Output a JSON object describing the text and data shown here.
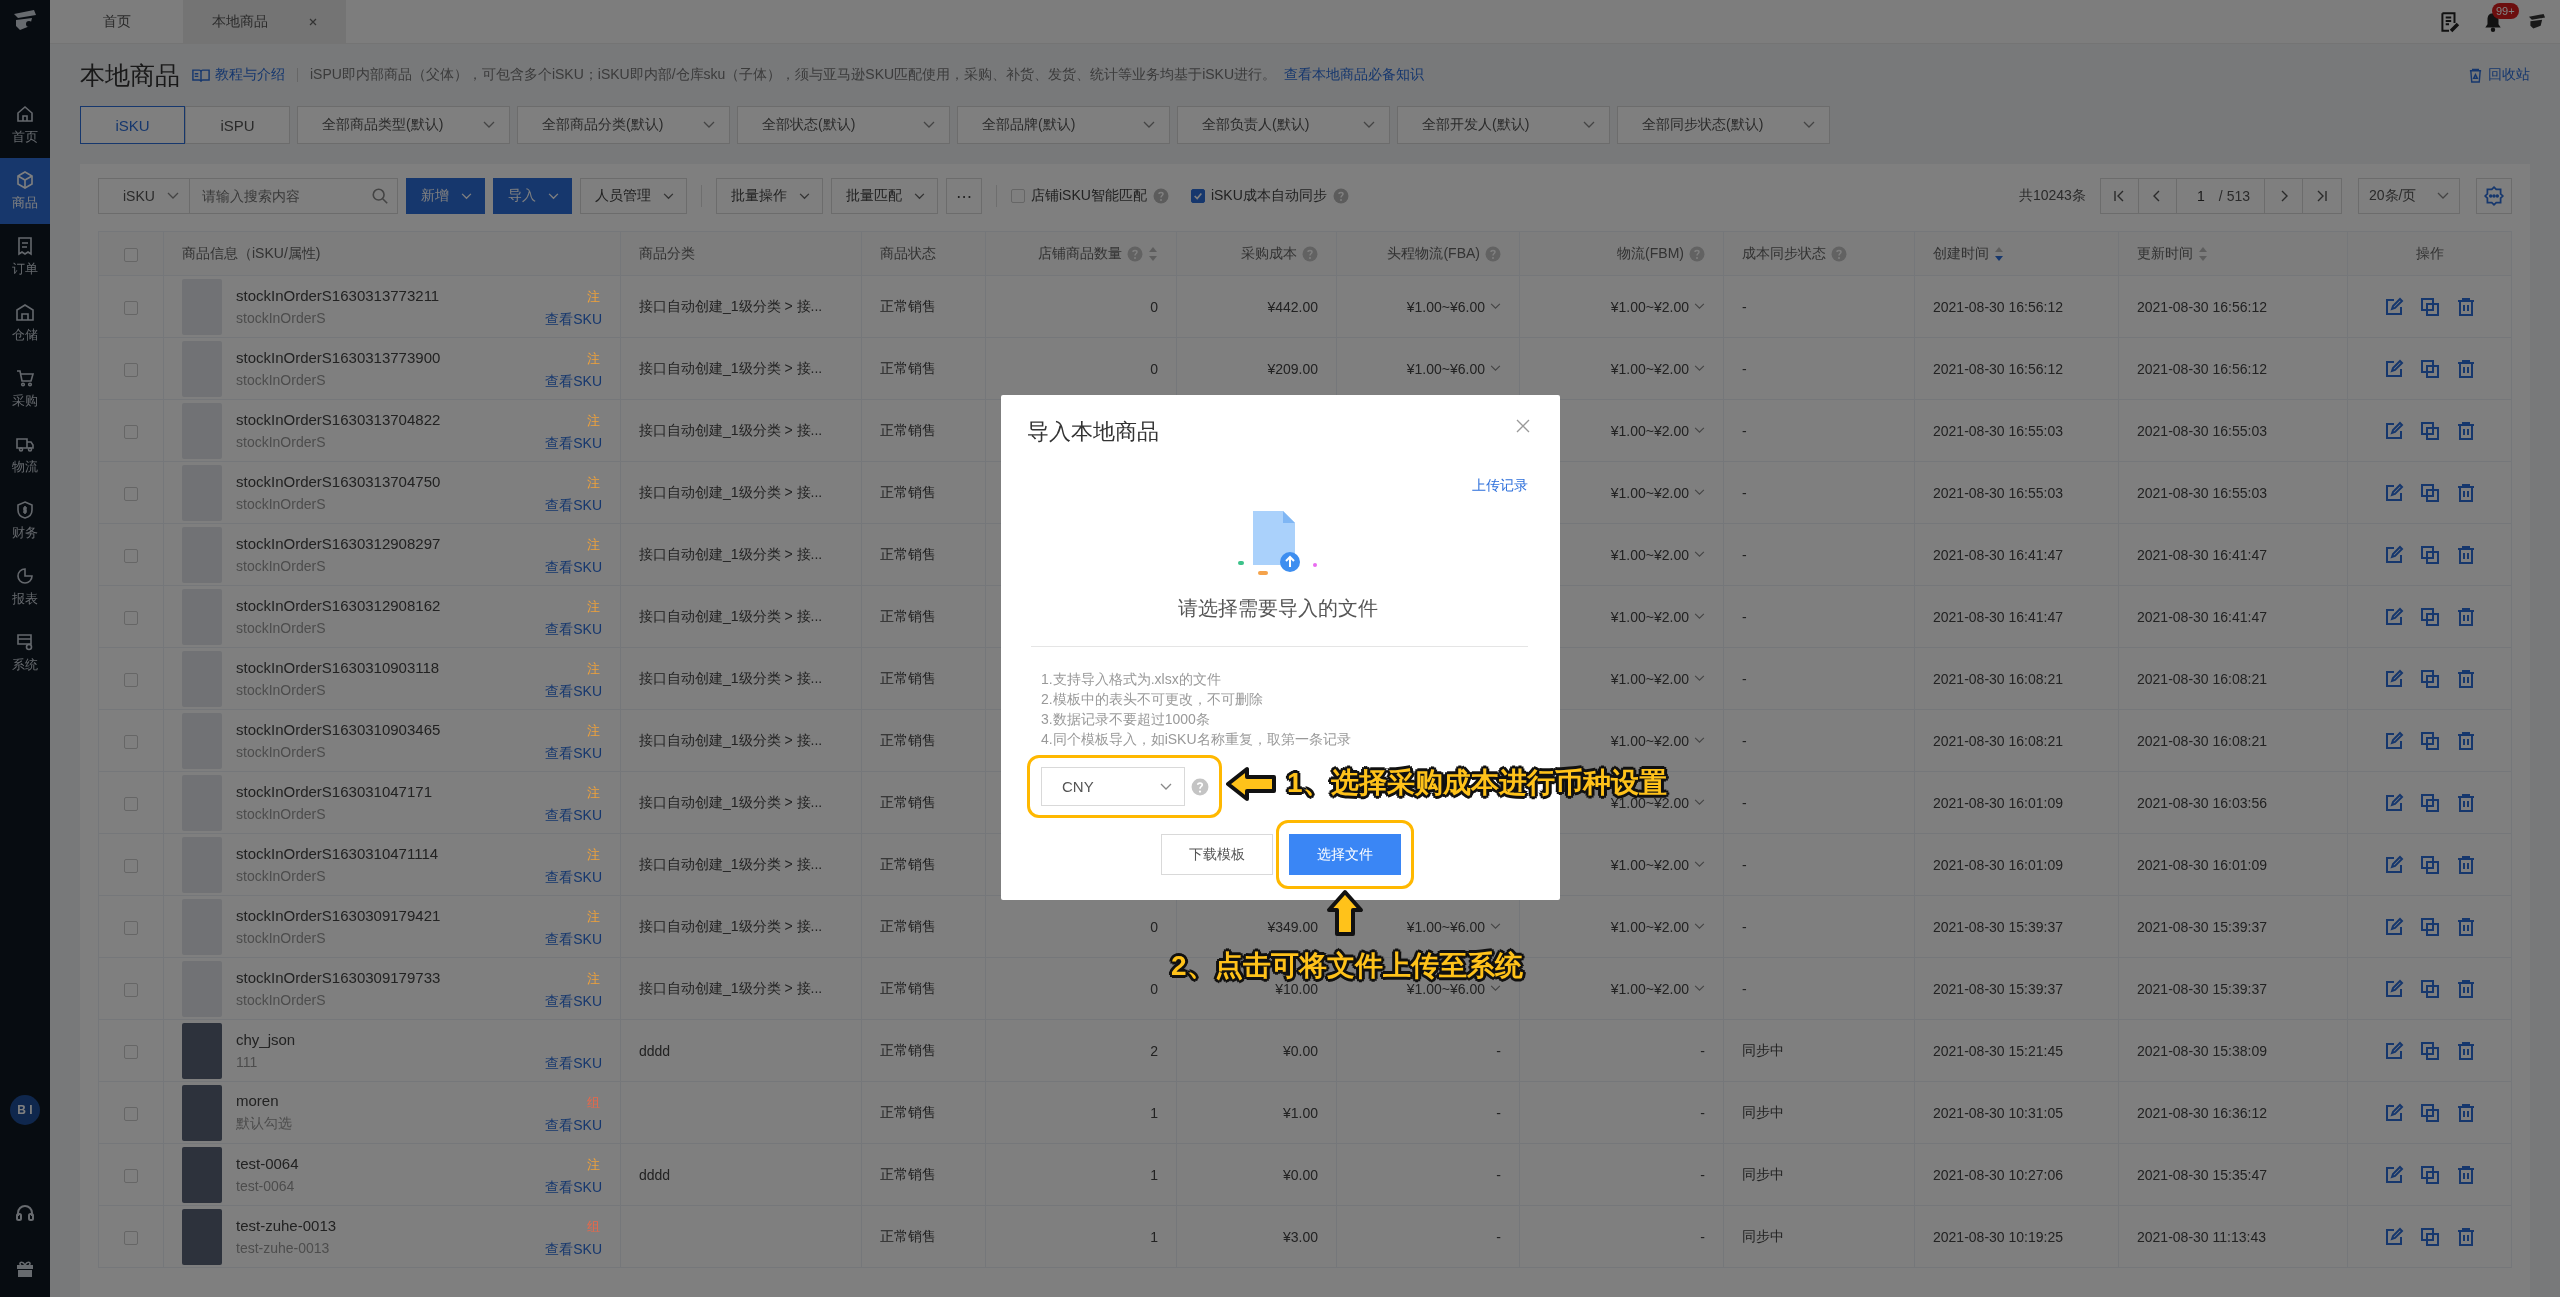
{
  "sidebar": {
    "items": [
      {
        "label": "首页",
        "kind": "home",
        "selected": false
      },
      {
        "label": "商品",
        "kind": "cube",
        "selected": true
      },
      {
        "label": "订单",
        "kind": "order",
        "selected": false
      },
      {
        "label": "仓储",
        "kind": "warehouse",
        "selected": false
      },
      {
        "label": "采购",
        "kind": "cart",
        "selected": false
      },
      {
        "label": "物流",
        "kind": "truck",
        "selected": false
      },
      {
        "label": "财务",
        "kind": "finance",
        "selected": false
      },
      {
        "label": "报表",
        "kind": "report",
        "selected": false
      },
      {
        "label": "系统",
        "kind": "system",
        "selected": false
      }
    ],
    "bi_badge": "B I"
  },
  "tabs": [
    {
      "label": "首页",
      "selected": false,
      "closable": false
    },
    {
      "label": "本地商品",
      "selected": true,
      "closable": true
    }
  ],
  "notification_count": "99+",
  "header": {
    "title": "本地商品",
    "tutorial_link": "教程与介绍",
    "description": "iSPU即内部商品（父体），可包含多个iSKU；iSKU即内部/仓库sku（子体），须与亚马逊SKU匹配使用，采购、补货、发货、统计等业务均基于iSKU进行。",
    "knowledge_link": "查看本地商品必备知识",
    "recycle_bin": "回收站"
  },
  "view_switch": [
    {
      "label": "iSKU",
      "selected": true
    },
    {
      "label": "iSPU",
      "selected": false
    }
  ],
  "filters": [
    "全部商品类型(默认)",
    "全部商品分类(默认)",
    "全部状态(默认)",
    "全部品牌(默认)",
    "全部负责人(默认)",
    "全部开发人(默认)",
    "全部同步状态(默认)"
  ],
  "toolbar": {
    "search_type": "iSKU",
    "search_placeholder": "请输入搜索内容",
    "button_groups": [
      [
        {
          "label": "新增",
          "kind": "primary"
        },
        {
          "label": "导入",
          "kind": "primary"
        },
        {
          "label": "人员管理",
          "kind": "dropdown"
        }
      ],
      [
        {
          "label": "批量操作",
          "kind": "dropdown"
        },
        {
          "label": "批量匹配",
          "kind": "dropdown"
        },
        {
          "label": "⋯",
          "kind": "more"
        }
      ]
    ],
    "checkboxes": [
      {
        "label": "店铺iSKU智能匹配",
        "checked": false
      },
      {
        "label": "iSKU成本自动同步",
        "checked": true
      }
    ]
  },
  "pagination": {
    "total": "共10243条",
    "page": "1",
    "pages": "/ 513",
    "page_size": "20条/页"
  },
  "table": {
    "select_all": {
      "checked": false
    },
    "columns": [
      {
        "label": "商品信息（iSKU/属性)",
        "kind": "plain"
      },
      {
        "label": "商品分类",
        "kind": "plain"
      },
      {
        "label": "商品状态",
        "kind": "plain"
      },
      {
        "label": "店铺商品数量",
        "kind": "help_sortable"
      },
      {
        "label": "采购成本",
        "kind": "help"
      },
      {
        "label": "头程物流(FBA)",
        "kind": "help"
      },
      {
        "label": "物流(FBM)",
        "kind": "help"
      },
      {
        "label": "成本同步状态",
        "kind": "help"
      },
      {
        "label": "创建时间",
        "kind": "sorted_desc"
      },
      {
        "label": "更新时间",
        "kind": "sortable"
      },
      {
        "label": "操作",
        "kind": "plain"
      }
    ],
    "rows": [
      {
        "selected": false,
        "photo": false,
        "name": "stockInOrderS1630313773211",
        "attr": "stockInOrderS",
        "tag": {
          "text": "注",
          "color": "#f0a23a"
        },
        "link": "查看SKU",
        "category": "接口自动创建_1级分类 > 接...",
        "status": "正常销售",
        "count": "0",
        "cost": "¥442.00",
        "fba": "¥1.00~¥6.00",
        "fbm": "¥1.00~¥2.00",
        "range_dropdown": true,
        "sync": "-",
        "created": "2021-08-30 16:56:12",
        "updated": "2021-08-30 16:56:12"
      },
      {
        "selected": false,
        "photo": false,
        "name": "stockInOrderS1630313773900",
        "attr": "stockInOrderS",
        "tag": {
          "text": "注",
          "color": "#f0a23a"
        },
        "link": "查看SKU",
        "category": "接口自动创建_1级分类 > 接...",
        "status": "正常销售",
        "count": "0",
        "cost": "¥209.00",
        "fba": "¥1.00~¥6.00",
        "fbm": "¥1.00~¥2.00",
        "range_dropdown": true,
        "sync": "-",
        "created": "2021-08-30 16:56:12",
        "updated": "2021-08-30 16:56:12"
      },
      {
        "selected": false,
        "photo": false,
        "name": "stockInOrderS1630313704822",
        "attr": "stockInOrderS",
        "tag": {
          "text": "注",
          "color": "#f0a23a"
        },
        "link": "查看SKU",
        "category": "接口自动创建_1级分类 > 接...",
        "status": "正常销售",
        "fbm": "¥1.00~¥2.00",
        "range_dropdown": true,
        "sync": "-",
        "created": "2021-08-30 16:55:03",
        "updated": "2021-08-30 16:55:03"
      },
      {
        "selected": false,
        "photo": false,
        "name": "stockInOrderS1630313704750",
        "attr": "stockInOrderS",
        "tag": {
          "text": "注",
          "color": "#f0a23a"
        },
        "link": "查看SKU",
        "category": "接口自动创建_1级分类 > 接...",
        "status": "正常销售",
        "fbm": "¥1.00~¥2.00",
        "range_dropdown": true,
        "sync": "-",
        "created": "2021-08-30 16:55:03",
        "updated": "2021-08-30 16:55:03"
      },
      {
        "selected": false,
        "photo": false,
        "name": "stockInOrderS1630312908297",
        "attr": "stockInOrderS",
        "tag": {
          "text": "注",
          "color": "#f0a23a"
        },
        "link": "查看SKU",
        "category": "接口自动创建_1级分类 > 接...",
        "status": "正常销售",
        "fbm": "¥1.00~¥2.00",
        "range_dropdown": true,
        "sync": "-",
        "created": "2021-08-30 16:41:47",
        "updated": "2021-08-30 16:41:47"
      },
      {
        "selected": false,
        "photo": false,
        "name": "stockInOrderS1630312908162",
        "attr": "stockInOrderS",
        "tag": {
          "text": "注",
          "color": "#f0a23a"
        },
        "link": "查看SKU",
        "category": "接口自动创建_1级分类 > 接...",
        "status": "正常销售",
        "fbm": "¥1.00~¥2.00",
        "range_dropdown": true,
        "sync": "-",
        "created": "2021-08-30 16:41:47",
        "updated": "2021-08-30 16:41:47"
      },
      {
        "selected": false,
        "photo": false,
        "name": "stockInOrderS1630310903118",
        "attr": "stockInOrderS",
        "tag": {
          "text": "注",
          "color": "#f0a23a"
        },
        "link": "查看SKU",
        "category": "接口自动创建_1级分类 > 接...",
        "status": "正常销售",
        "fbm": "¥1.00~¥2.00",
        "range_dropdown": true,
        "sync": "-",
        "created": "2021-08-30 16:08:21",
        "updated": "2021-08-30 16:08:21"
      },
      {
        "selected": false,
        "photo": false,
        "name": "stockInOrderS1630310903465",
        "attr": "stockInOrderS",
        "tag": {
          "text": "注",
          "color": "#f0a23a"
        },
        "link": "查看SKU",
        "category": "接口自动创建_1级分类 > 接...",
        "status": "正常销售",
        "fbm": "¥1.00~¥2.00",
        "range_dropdown": true,
        "sync": "-",
        "created": "2021-08-30 16:08:21",
        "updated": "2021-08-30 16:08:21"
      },
      {
        "selected": false,
        "photo": false,
        "name": "stockInOrderS163031047171",
        "attr": "stockInOrderS",
        "tag": {
          "text": "注",
          "color": "#f0a23a"
        },
        "link": "查看SKU",
        "category": "接口自动创建_1级分类 > 接...",
        "status": "正常销售",
        "fbm": "¥1.00~¥2.00",
        "range_dropdown": true,
        "sync": "-",
        "created": "2021-08-30 16:01:09",
        "updated": "2021-08-30 16:03:56"
      },
      {
        "selected": false,
        "photo": false,
        "name": "stockInOrderS1630310471114",
        "attr": "stockInOrderS",
        "tag": {
          "text": "注",
          "color": "#f0a23a"
        },
        "link": "查看SKU",
        "category": "接口自动创建_1级分类 > 接...",
        "status": "正常销售",
        "fbm": "¥1.00~¥2.00",
        "range_dropdown": true,
        "sync": "-",
        "created": "2021-08-30 16:01:09",
        "updated": "2021-08-30 16:01:09"
      },
      {
        "selected": false,
        "photo": false,
        "name": "stockInOrderS1630309179421",
        "attr": "stockInOrderS",
        "tag": {
          "text": "注",
          "color": "#f0a23a"
        },
        "link": "查看SKU",
        "category": "接口自动创建_1级分类 > 接...",
        "status": "正常销售",
        "count": "0",
        "cost": "¥349.00",
        "fba": "¥1.00~¥6.00",
        "fbm": "¥1.00~¥2.00",
        "range_dropdown": true,
        "sync": "-",
        "created": "2021-08-30 15:39:37",
        "updated": "2021-08-30 15:39:37"
      },
      {
        "selected": false,
        "photo": false,
        "name": "stockInOrderS1630309179733",
        "attr": "stockInOrderS",
        "tag": {
          "text": "注",
          "color": "#f0a23a"
        },
        "link": "查看SKU",
        "category": "接口自动创建_1级分类 > 接...",
        "status": "正常销售",
        "count": "0",
        "cost": "¥10.00",
        "fba": "¥1.00~¥6.00",
        "fbm": "¥1.00~¥2.00",
        "range_dropdown": true,
        "sync": "-",
        "created": "2021-08-30 15:39:37",
        "updated": "2021-08-30 15:39:37"
      },
      {
        "selected": false,
        "photo": true,
        "name": "chy_json",
        "attr": "111",
        "link": "查看SKU",
        "category": "dddd",
        "status": "正常销售",
        "count": "2",
        "cost": "¥0.00",
        "fba": "-",
        "fbm": "-",
        "range_dropdown": false,
        "sync": "同步中",
        "created": "2021-08-30 15:21:45",
        "updated": "2021-08-30 15:38:09"
      },
      {
        "selected": false,
        "photo": true,
        "name": "moren",
        "attr": "默认勾选",
        "tag": {
          "text": "组",
          "color": "#e8684a"
        },
        "link": "查看SKU",
        "status": "正常销售",
        "count": "1",
        "cost": "¥1.00",
        "fba": "-",
        "fbm": "-",
        "range_dropdown": false,
        "sync": "同步中",
        "created": "2021-08-30 10:31:05",
        "updated": "2021-08-30 16:36:12"
      },
      {
        "selected": false,
        "photo": true,
        "name": "test-0064",
        "attr": "test-0064",
        "tag": {
          "text": "注",
          "color": "#f0a23a"
        },
        "link": "查看SKU",
        "category": "dddd",
        "status": "正常销售",
        "count": "1",
        "cost": "¥0.00",
        "fba": "-",
        "fbm": "-",
        "range_dropdown": false,
        "sync": "同步中",
        "created": "2021-08-30 10:27:06",
        "updated": "2021-08-30 15:35:47"
      },
      {
        "selected": false,
        "photo": true,
        "name": "test-zuhe-0013",
        "attr": "test-zuhe-0013",
        "tag": {
          "text": "组",
          "color": "#e8684a"
        },
        "link": "查看SKU",
        "status": "正常销售",
        "count": "1",
        "cost": "¥3.00",
        "fba": "-",
        "fbm": "-",
        "range_dropdown": false,
        "sync": "同步中",
        "created": "2021-08-30 10:19:25",
        "updated": "2021-08-30 11:13:43"
      }
    ]
  },
  "modal": {
    "title": "导入本地商品",
    "upload_history_link": "上传记录",
    "prompt": "请选择需要导入的文件",
    "instructions": [
      "1.支持导入格式为.xlsx的文件",
      "2.模板中的表头不可更改，不可删除",
      "3.数据记录不要超过1000条",
      "4.同个模板导入，如iSKU名称重复，取第一条记录"
    ],
    "currency": "CNY",
    "buttons": [
      {
        "label": "下载模板",
        "kind": "default",
        "highlighted": false
      },
      {
        "label": "选择文件",
        "kind": "primary",
        "highlighted": true
      }
    ]
  },
  "annotations": [
    {
      "text": "1、选择采购成本进行币种设置",
      "kind": "left"
    },
    {
      "text": "2、点击可将文件上传至系统",
      "kind": "up"
    }
  ]
}
